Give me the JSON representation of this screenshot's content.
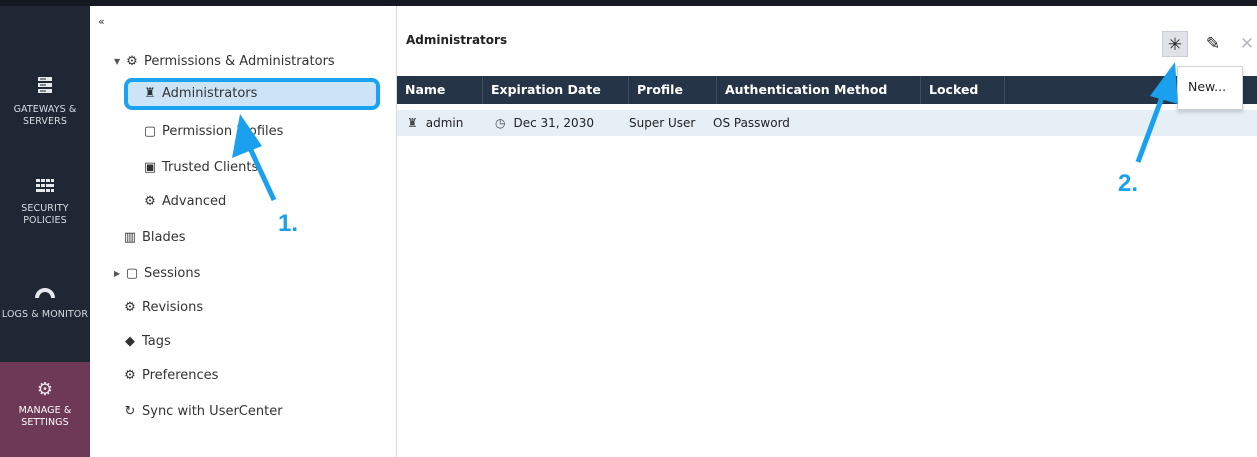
{
  "leftnav": {
    "items": [
      {
        "icon": "server-icon",
        "label": "GATEWAYS & SERVERS"
      },
      {
        "icon": "grid-icon",
        "label": "SECURITY POLICIES"
      },
      {
        "icon": "gauge-icon",
        "label": "LOGS & MONITOR"
      },
      {
        "icon": "gear-icon",
        "label": "MANAGE & SETTINGS"
      }
    ]
  },
  "tree": {
    "collapse_glyph": "«",
    "items": [
      {
        "label": "Permissions & Administrators"
      },
      {
        "label": "Administrators"
      },
      {
        "label": "Permission Profiles"
      },
      {
        "label": "Trusted Clients"
      },
      {
        "label": "Advanced"
      },
      {
        "label": "Blades"
      },
      {
        "label": "Sessions"
      },
      {
        "label": "Revisions"
      },
      {
        "label": "Tags"
      },
      {
        "label": "Preferences"
      },
      {
        "label": "Sync with UserCenter"
      }
    ]
  },
  "main": {
    "title": "Administrators",
    "table": {
      "columns": [
        "Name",
        "Expiration Date",
        "Profile",
        "Authentication Method",
        "Locked"
      ],
      "rows": [
        {
          "name": "admin",
          "expiration": "Dec 31, 2030",
          "profile": "Super User",
          "auth": "OS Password",
          "locked": ""
        }
      ]
    },
    "popup": {
      "new_label": "New..."
    }
  },
  "annotations": {
    "step1": "1.",
    "step2": "2."
  },
  "colors": {
    "nav_bg": "#1e2733",
    "nav_active": "#6e3857",
    "table_header": "#253446",
    "selection_fill": "#cce4f6",
    "highlight_blue": "#1aa3f0"
  }
}
